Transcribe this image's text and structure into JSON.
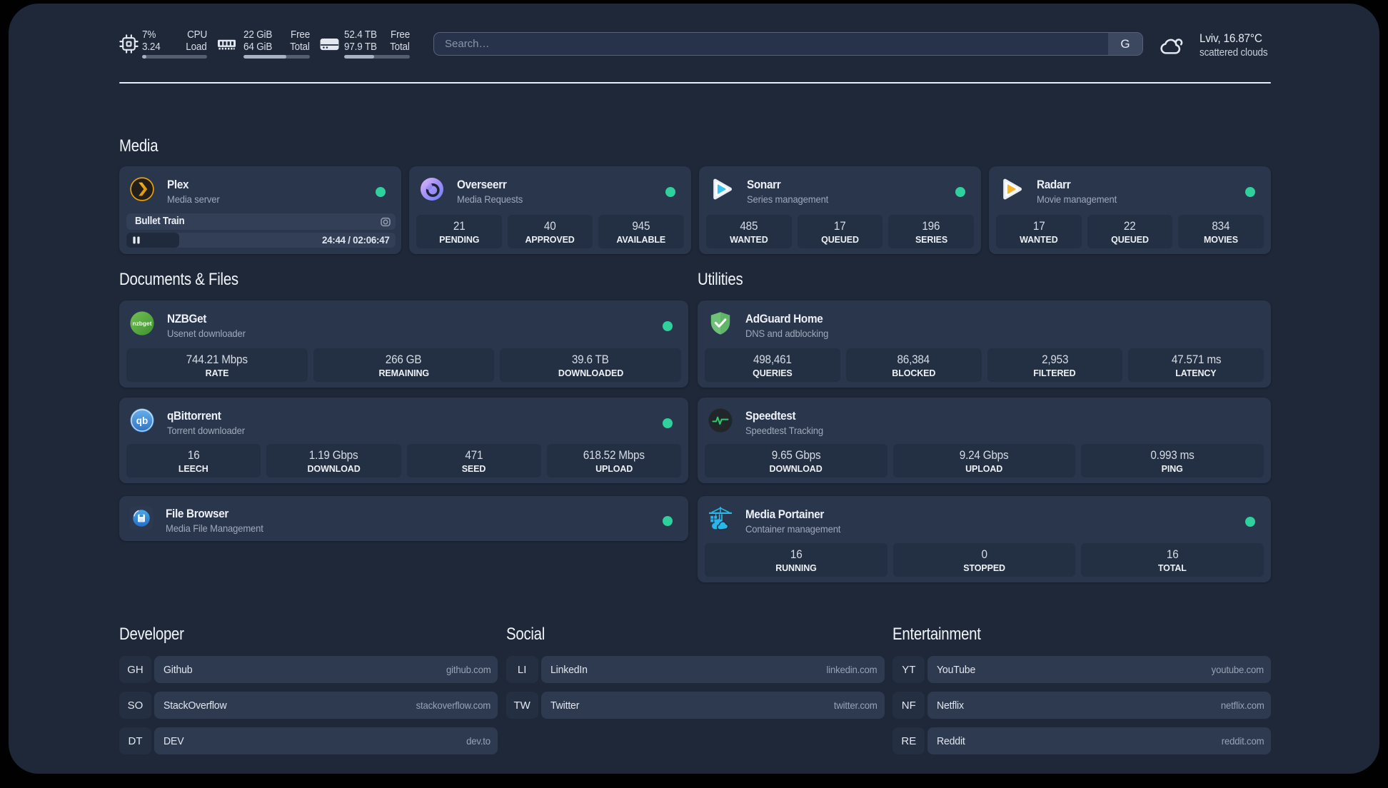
{
  "topbar": {
    "resources": [
      {
        "icon": "cpu-icon",
        "col1": [
          "7%",
          "3.24"
        ],
        "col2": [
          "CPU",
          "Load"
        ],
        "percent": 7
      },
      {
        "icon": "memory-icon",
        "col1": [
          "22 GiB",
          "64 GiB"
        ],
        "col2": [
          "Free",
          "Total"
        ],
        "percent": 64
      },
      {
        "icon": "disk-icon",
        "col1": [
          "52.4 TB",
          "97.9 TB"
        ],
        "col2": [
          "Free",
          "Total"
        ],
        "percent": 46
      }
    ],
    "search": {
      "placeholder": "Search…",
      "button_label": "G"
    },
    "weather": {
      "icon": "cloud-icon",
      "title": "Lviv, 16.87°C",
      "subtitle": "scattered clouds"
    }
  },
  "sections": {
    "media": {
      "title": "Media",
      "cards": [
        {
          "icon": "plex-icon",
          "title": "Plex",
          "subtitle": "Media server",
          "online": true,
          "player": {
            "track": "Bullet Train",
            "time": "24:44 / 02:06:47"
          }
        },
        {
          "icon": "overseerr-icon",
          "title": "Overseerr",
          "subtitle": "Media Requests",
          "online": true,
          "stats": [
            {
              "value": "21",
              "label": "PENDING"
            },
            {
              "value": "40",
              "label": "APPROVED"
            },
            {
              "value": "945",
              "label": "AVAILABLE"
            }
          ]
        },
        {
          "icon": "sonarr-icon",
          "title": "Sonarr",
          "subtitle": "Series management",
          "online": true,
          "stats": [
            {
              "value": "485",
              "label": "WANTED"
            },
            {
              "value": "17",
              "label": "QUEUED"
            },
            {
              "value": "196",
              "label": "SERIES"
            }
          ]
        },
        {
          "icon": "radarr-icon",
          "title": "Radarr",
          "subtitle": "Movie management",
          "online": true,
          "stats": [
            {
              "value": "17",
              "label": "WANTED"
            },
            {
              "value": "22",
              "label": "QUEUED"
            },
            {
              "value": "834",
              "label": "MOVIES"
            }
          ]
        }
      ]
    },
    "documents": {
      "title": "Documents & Files",
      "cards": [
        {
          "icon": "nzbget-icon",
          "title": "NZBGet",
          "subtitle": "Usenet downloader",
          "online": true,
          "stats": [
            {
              "value": "744.21 Mbps",
              "label": "RATE"
            },
            {
              "value": "266 GB",
              "label": "REMAINING"
            },
            {
              "value": "39.6 TB",
              "label": "DOWNLOADED"
            }
          ]
        },
        {
          "icon": "qbittorrent-icon",
          "title": "qBittorrent",
          "subtitle": "Torrent downloader",
          "online": true,
          "stats": [
            {
              "value": "16",
              "label": "LEECH"
            },
            {
              "value": "1.19 Gbps",
              "label": "DOWNLOAD"
            },
            {
              "value": "471",
              "label": "SEED"
            },
            {
              "value": "618.52 Mbps",
              "label": "UPLOAD"
            }
          ]
        },
        {
          "icon": "filebrowser-icon",
          "title": "File Browser",
          "subtitle": "Media File Management",
          "online": true
        }
      ]
    },
    "utilities": {
      "title": "Utilities",
      "cards": [
        {
          "icon": "adguard-icon",
          "title": "AdGuard Home",
          "subtitle": "DNS and adblocking",
          "online": false,
          "stats": [
            {
              "value": "498,461",
              "label": "QUERIES"
            },
            {
              "value": "86,384",
              "label": "BLOCKED"
            },
            {
              "value": "2,953",
              "label": "FILTERED"
            },
            {
              "value": "47.571 ms",
              "label": "LATENCY"
            }
          ]
        },
        {
          "icon": "speedtest-icon",
          "title": "Speedtest",
          "subtitle": "Speedtest Tracking",
          "online": false,
          "stats": [
            {
              "value": "9.65 Gbps",
              "label": "DOWNLOAD"
            },
            {
              "value": "9.24 Gbps",
              "label": "UPLOAD"
            },
            {
              "value": "0.993 ms",
              "label": "PING"
            }
          ]
        },
        {
          "icon": "portainer-icon",
          "title": "Media Portainer",
          "subtitle": "Container management",
          "online": true,
          "stats": [
            {
              "value": "16",
              "label": "RUNNING"
            },
            {
              "value": "0",
              "label": "STOPPED"
            },
            {
              "value": "16",
              "label": "TOTAL"
            }
          ]
        }
      ]
    }
  },
  "bookmarks": [
    {
      "title": "Developer",
      "items": [
        {
          "abbr": "GH",
          "name": "Github",
          "url": "github.com"
        },
        {
          "abbr": "SO",
          "name": "StackOverflow",
          "url": "stackoverflow.com"
        },
        {
          "abbr": "DT",
          "name": "DEV",
          "url": "dev.to"
        }
      ]
    },
    {
      "title": "Social",
      "items": [
        {
          "abbr": "LI",
          "name": "LinkedIn",
          "url": "linkedin.com"
        },
        {
          "abbr": "TW",
          "name": "Twitter",
          "url": "twitter.com"
        }
      ]
    },
    {
      "title": "Entertainment",
      "items": [
        {
          "abbr": "YT",
          "name": "YouTube",
          "url": "youtube.com"
        },
        {
          "abbr": "NF",
          "name": "Netflix",
          "url": "netflix.com"
        },
        {
          "abbr": "RE",
          "name": "Reddit",
          "url": "reddit.com"
        }
      ]
    }
  ],
  "icon_text": {
    "nzbget": "nzbget",
    "qbittorrent": "qb"
  },
  "colors": {
    "status_online": "#2fd09c",
    "background": "#1e2839",
    "card": "#2a364b"
  }
}
